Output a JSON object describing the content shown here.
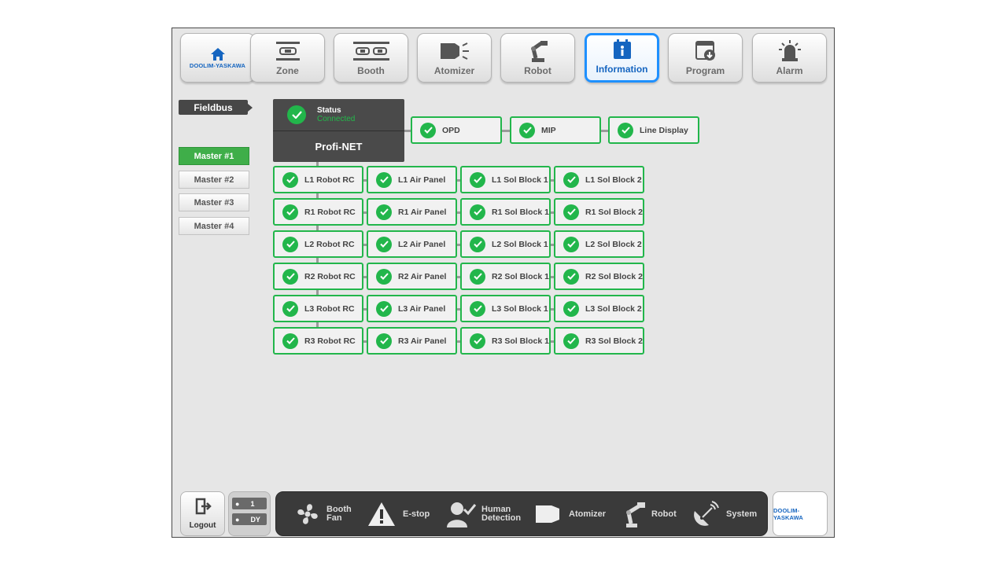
{
  "nav": {
    "brand": "DOOLIM-YASKAWA",
    "items": [
      {
        "label": "Zone",
        "icon": "zone-icon"
      },
      {
        "label": "Booth",
        "icon": "booth-icon"
      },
      {
        "label": "Atomizer",
        "icon": "atomizer-icon"
      },
      {
        "label": "Robot",
        "icon": "robot-icon"
      },
      {
        "label": "Information",
        "icon": "info-icon",
        "active": true
      },
      {
        "label": "Program",
        "icon": "program-icon"
      },
      {
        "label": "Alarm",
        "icon": "alarm-icon"
      }
    ]
  },
  "sidebar": {
    "tab": "Fieldbus",
    "masters": [
      {
        "label": "Master #1",
        "active": true
      },
      {
        "label": "Master #2"
      },
      {
        "label": "Master #3"
      },
      {
        "label": "Master #4"
      }
    ]
  },
  "status": {
    "label": "Status",
    "value": "Connected",
    "network": "Profi-NET"
  },
  "top_devices": [
    "OPD",
    "MIP",
    "Line Display"
  ],
  "device_grid": [
    [
      "L1 Robot RC",
      "L1 Air Panel",
      "L1 Sol Block 1",
      "L1 Sol Block 2"
    ],
    [
      "R1 Robot RC",
      "R1 Air Panel",
      "R1 Sol Block 1",
      "R1 Sol Block 2"
    ],
    [
      "L2 Robot RC",
      "L2 Air Panel",
      "L2 Sol Block 1",
      "L2 Sol Block 2"
    ],
    [
      "R2 Robot RC",
      "R2 Air Panel",
      "R2 Sol Block 1",
      "R2 Sol Block 2"
    ],
    [
      "L3 Robot RC",
      "L3 Air Panel",
      "L3 Sol Block 1",
      "L3 Sol Block 2"
    ],
    [
      "R3 Robot RC",
      "R3 Air Panel",
      "R3 Sol Block 1",
      "R3 Sol Block 2"
    ]
  ],
  "bottom": {
    "logout": "Logout",
    "user_level": "1",
    "user_name": "DY",
    "status_items": [
      {
        "line1": "Booth",
        "line2": "Fan",
        "icon": "fan-icon"
      },
      {
        "line1": "E-stop",
        "line2": "",
        "icon": "warning-icon"
      },
      {
        "line1": "Human",
        "line2": "Detection",
        "icon": "human-detection-icon"
      },
      {
        "line1": "Atomizer",
        "line2": "",
        "icon": "atomizer-icon"
      },
      {
        "line1": "Robot",
        "line2": "",
        "icon": "robot-icon"
      },
      {
        "line1": "System",
        "line2": "",
        "icon": "satellite-icon"
      }
    ],
    "brand": "DOOLIM-YASKAWA"
  },
  "colors": {
    "ok_green": "#22b64b",
    "active_blue": "#1e90ff",
    "master_active": "#3fae49",
    "panel_dark": "#4a4a4a"
  }
}
